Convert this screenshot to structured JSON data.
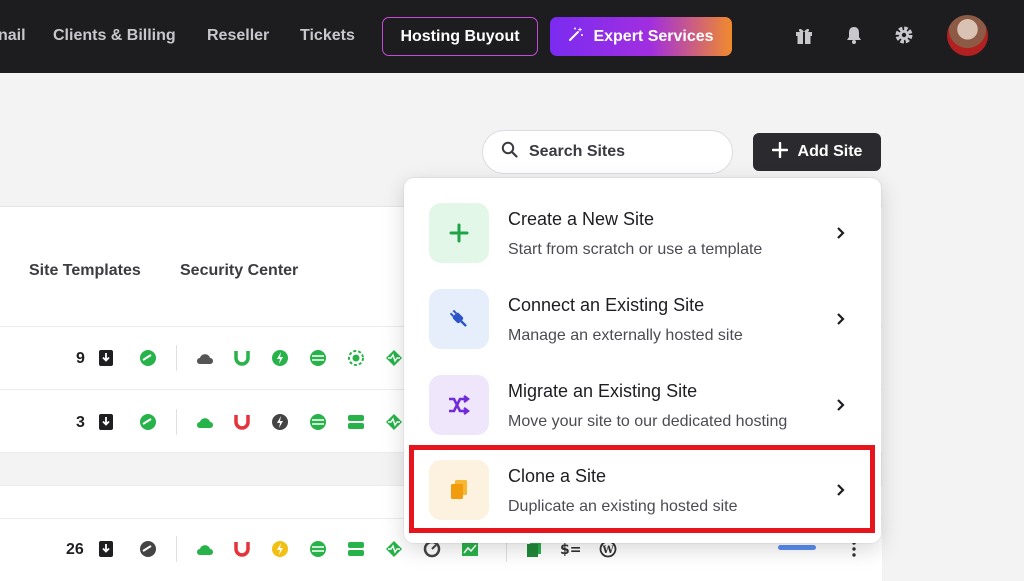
{
  "nav": {
    "partial_link": "nail",
    "links": [
      "Clients & Billing",
      "Reseller",
      "Tickets"
    ],
    "buyout_label": "Hosting Buyout",
    "expert_label": "Expert Services",
    "icons": [
      "gift-icon",
      "bell-icon",
      "gear-icon",
      "avatar"
    ]
  },
  "toolbar": {
    "search_placeholder": "Search Sites",
    "add_site_label": "Add Site"
  },
  "table": {
    "headers": [
      "Site Templates",
      "Security Center"
    ],
    "rows": [
      {
        "count": "9"
      },
      {
        "count": "3"
      },
      {
        "count": "26"
      }
    ]
  },
  "menu": {
    "items": [
      {
        "title": "Create a New Site",
        "desc": "Start from scratch or use a template",
        "icon": "plus-icon",
        "icon_bg": "#e3f7e8",
        "icon_color": "#1ea446"
      },
      {
        "title": "Connect an Existing Site",
        "desc": "Manage an externally hosted site",
        "icon": "plug-icon",
        "icon_bg": "#e6eefc",
        "icon_color": "#2b54c9"
      },
      {
        "title": "Migrate an Existing Site",
        "desc": "Move your site to our dedicated hosting",
        "icon": "migrate-arrows-icon",
        "icon_bg": "#efe6fb",
        "icon_color": "#6f2bd8"
      },
      {
        "title": "Clone a Site",
        "desc": "Duplicate an existing hosted site",
        "icon": "clone-copy-icon",
        "icon_bg": "#fdf1df",
        "icon_color": "#f2a414"
      }
    ]
  },
  "colors": {
    "nav_bg": "#1d1d20",
    "highlight": "#e5141d",
    "green": "#28b34a"
  }
}
